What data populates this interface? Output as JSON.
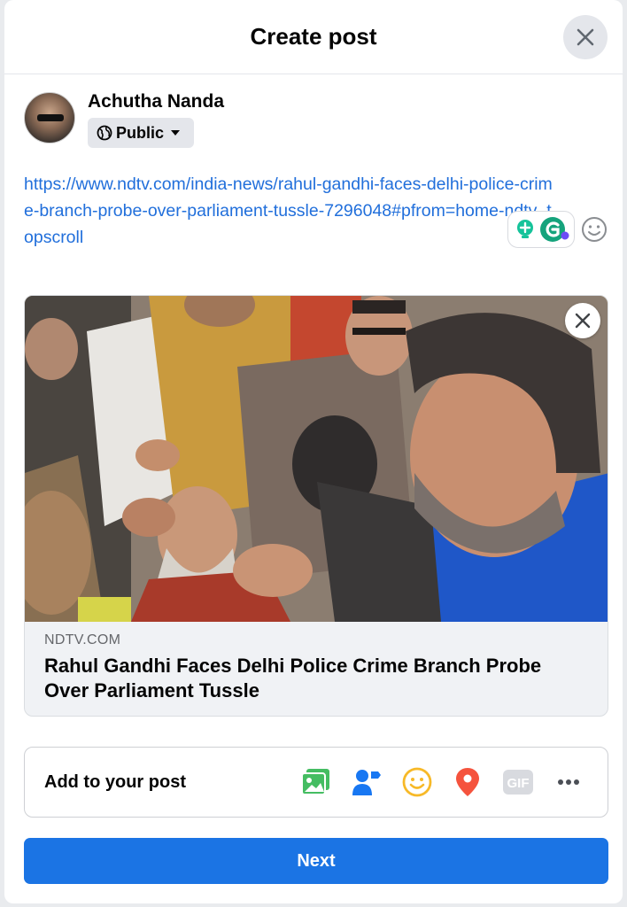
{
  "dialog": {
    "title": "Create post",
    "close_icon": "close-icon"
  },
  "user": {
    "name": "Achutha Nanda",
    "privacy_label": "Public",
    "privacy_icon": "globe-icon"
  },
  "post": {
    "text": "https://www.ndtv.com/india-news/rahul-gandhi-faces-delhi-police-crime-branch-probe-over-parliament-tussle-7296048#pfrom=home-ndtv_topscroll"
  },
  "link_preview": {
    "domain": "NDTV.COM",
    "title": "Rahul Gandhi Faces Delhi Police Crime Branch Probe Over Parliament Tussle"
  },
  "add_to_post": {
    "label": "Add to your post",
    "icons": [
      "photo-video-icon",
      "tag-people-icon",
      "feeling-icon",
      "check-in-icon",
      "gif-icon",
      "more-icon"
    ],
    "gif_text": "GIF"
  },
  "footer": {
    "next_label": "Next"
  },
  "colors": {
    "primary": "#1b74e4",
    "link_text": "#216fdb",
    "photo_green": "#45bd62",
    "tag_blue": "#1877f2",
    "feeling_yellow": "#f7b928",
    "checkin_red": "#f5533d",
    "grammarly_green": "#15c39a"
  }
}
